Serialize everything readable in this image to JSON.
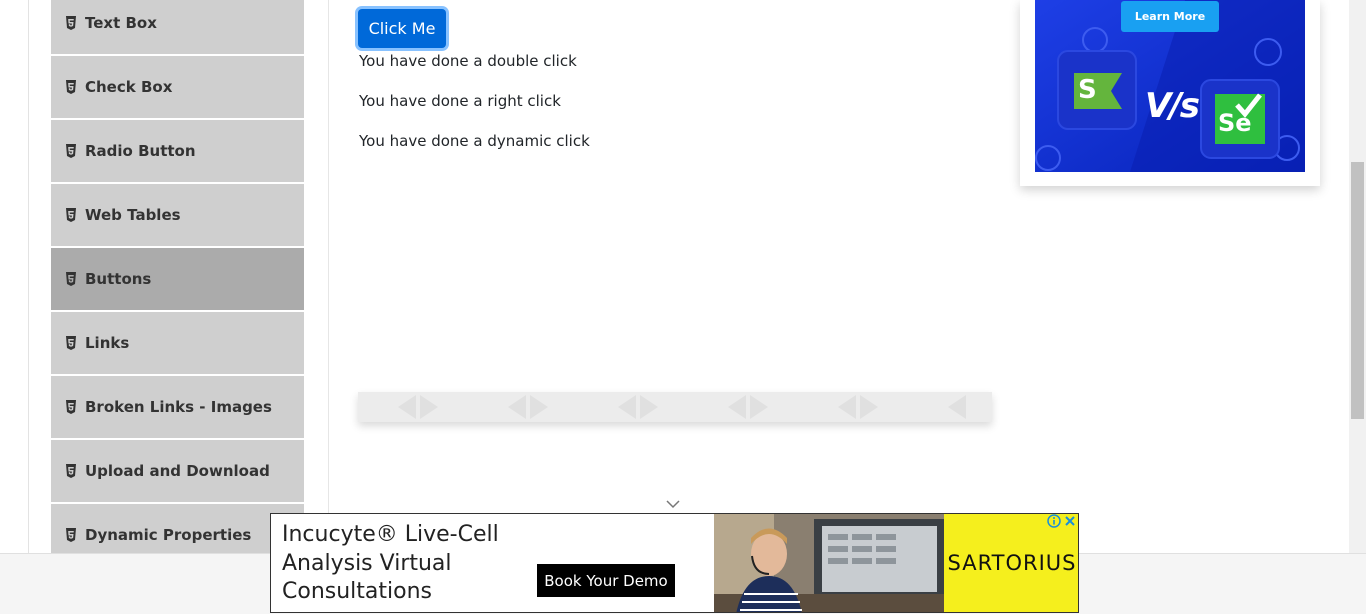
{
  "sidebar": {
    "items": [
      {
        "label": "Text Box",
        "icon": "html5-icon",
        "active": false
      },
      {
        "label": "Check Box",
        "icon": "html5-icon",
        "active": false
      },
      {
        "label": "Radio Button",
        "icon": "html5-icon",
        "active": false
      },
      {
        "label": "Web Tables",
        "icon": "html5-icon",
        "active": false
      },
      {
        "label": "Buttons",
        "icon": "html5-icon",
        "active": true
      },
      {
        "label": "Links",
        "icon": "html5-icon",
        "active": false
      },
      {
        "label": "Broken Links - Images",
        "icon": "html5-icon",
        "active": false
      },
      {
        "label": "Upload and Download",
        "icon": "html5-icon",
        "active": false
      },
      {
        "label": "Dynamic Properties",
        "icon": "html5-icon",
        "active": false
      }
    ]
  },
  "main": {
    "click_button_label": "Click Me",
    "messages": [
      "You have done a double click",
      "You have done a right click",
      "You have done a dynamic click"
    ]
  },
  "promo": {
    "button_label": "Learn More",
    "vs_text": "V/s",
    "left_logo_letter": "S",
    "right_logo_text": "Se"
  },
  "ad": {
    "headline": "Incucyte® Live-Cell Analysis Virtual Consultations",
    "button_label": "Book Your Demo",
    "brand": "SARTORIUS",
    "info_icon": "info-icon",
    "close_icon": "close-icon"
  },
  "colors": {
    "primary_button": "#0069d9",
    "menu_bg": "#cfcfcf",
    "menu_active_bg": "#ababab",
    "promo_blue": "#0a2fd6",
    "ad_yellow": "#f5ef1d"
  }
}
